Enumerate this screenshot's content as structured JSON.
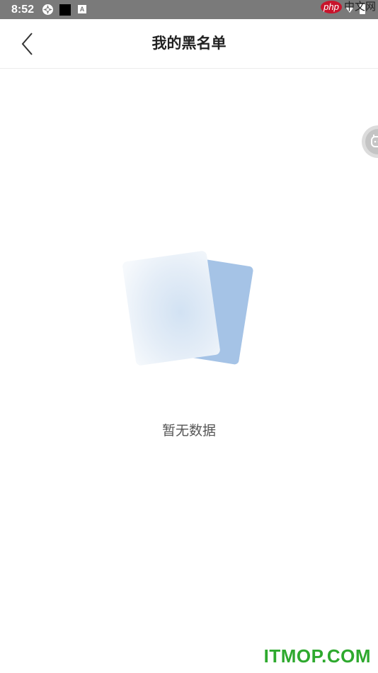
{
  "status_bar": {
    "time": "8:52",
    "icons": [
      "aperture-icon",
      "black-square-icon",
      "a-letter-icon",
      "wifi-icon",
      "battery-icon"
    ],
    "a_icon_text": "A"
  },
  "watermark_top": {
    "badge": "php",
    "text": "中文网"
  },
  "nav": {
    "back_icon": "chevron-left-icon",
    "title": "我的黑名单"
  },
  "float_button": {
    "icon": "support-icon"
  },
  "empty_state": {
    "icon": "empty-documents-icon",
    "message": "暂无数据"
  },
  "watermark_bottom": {
    "text": "ITMOP.COM"
  },
  "colors": {
    "status_bar": "#7a7a7a",
    "back_card": "#a5c3e6",
    "front_card": "#eaf1f9",
    "watermark_green": "#2ea92e"
  }
}
